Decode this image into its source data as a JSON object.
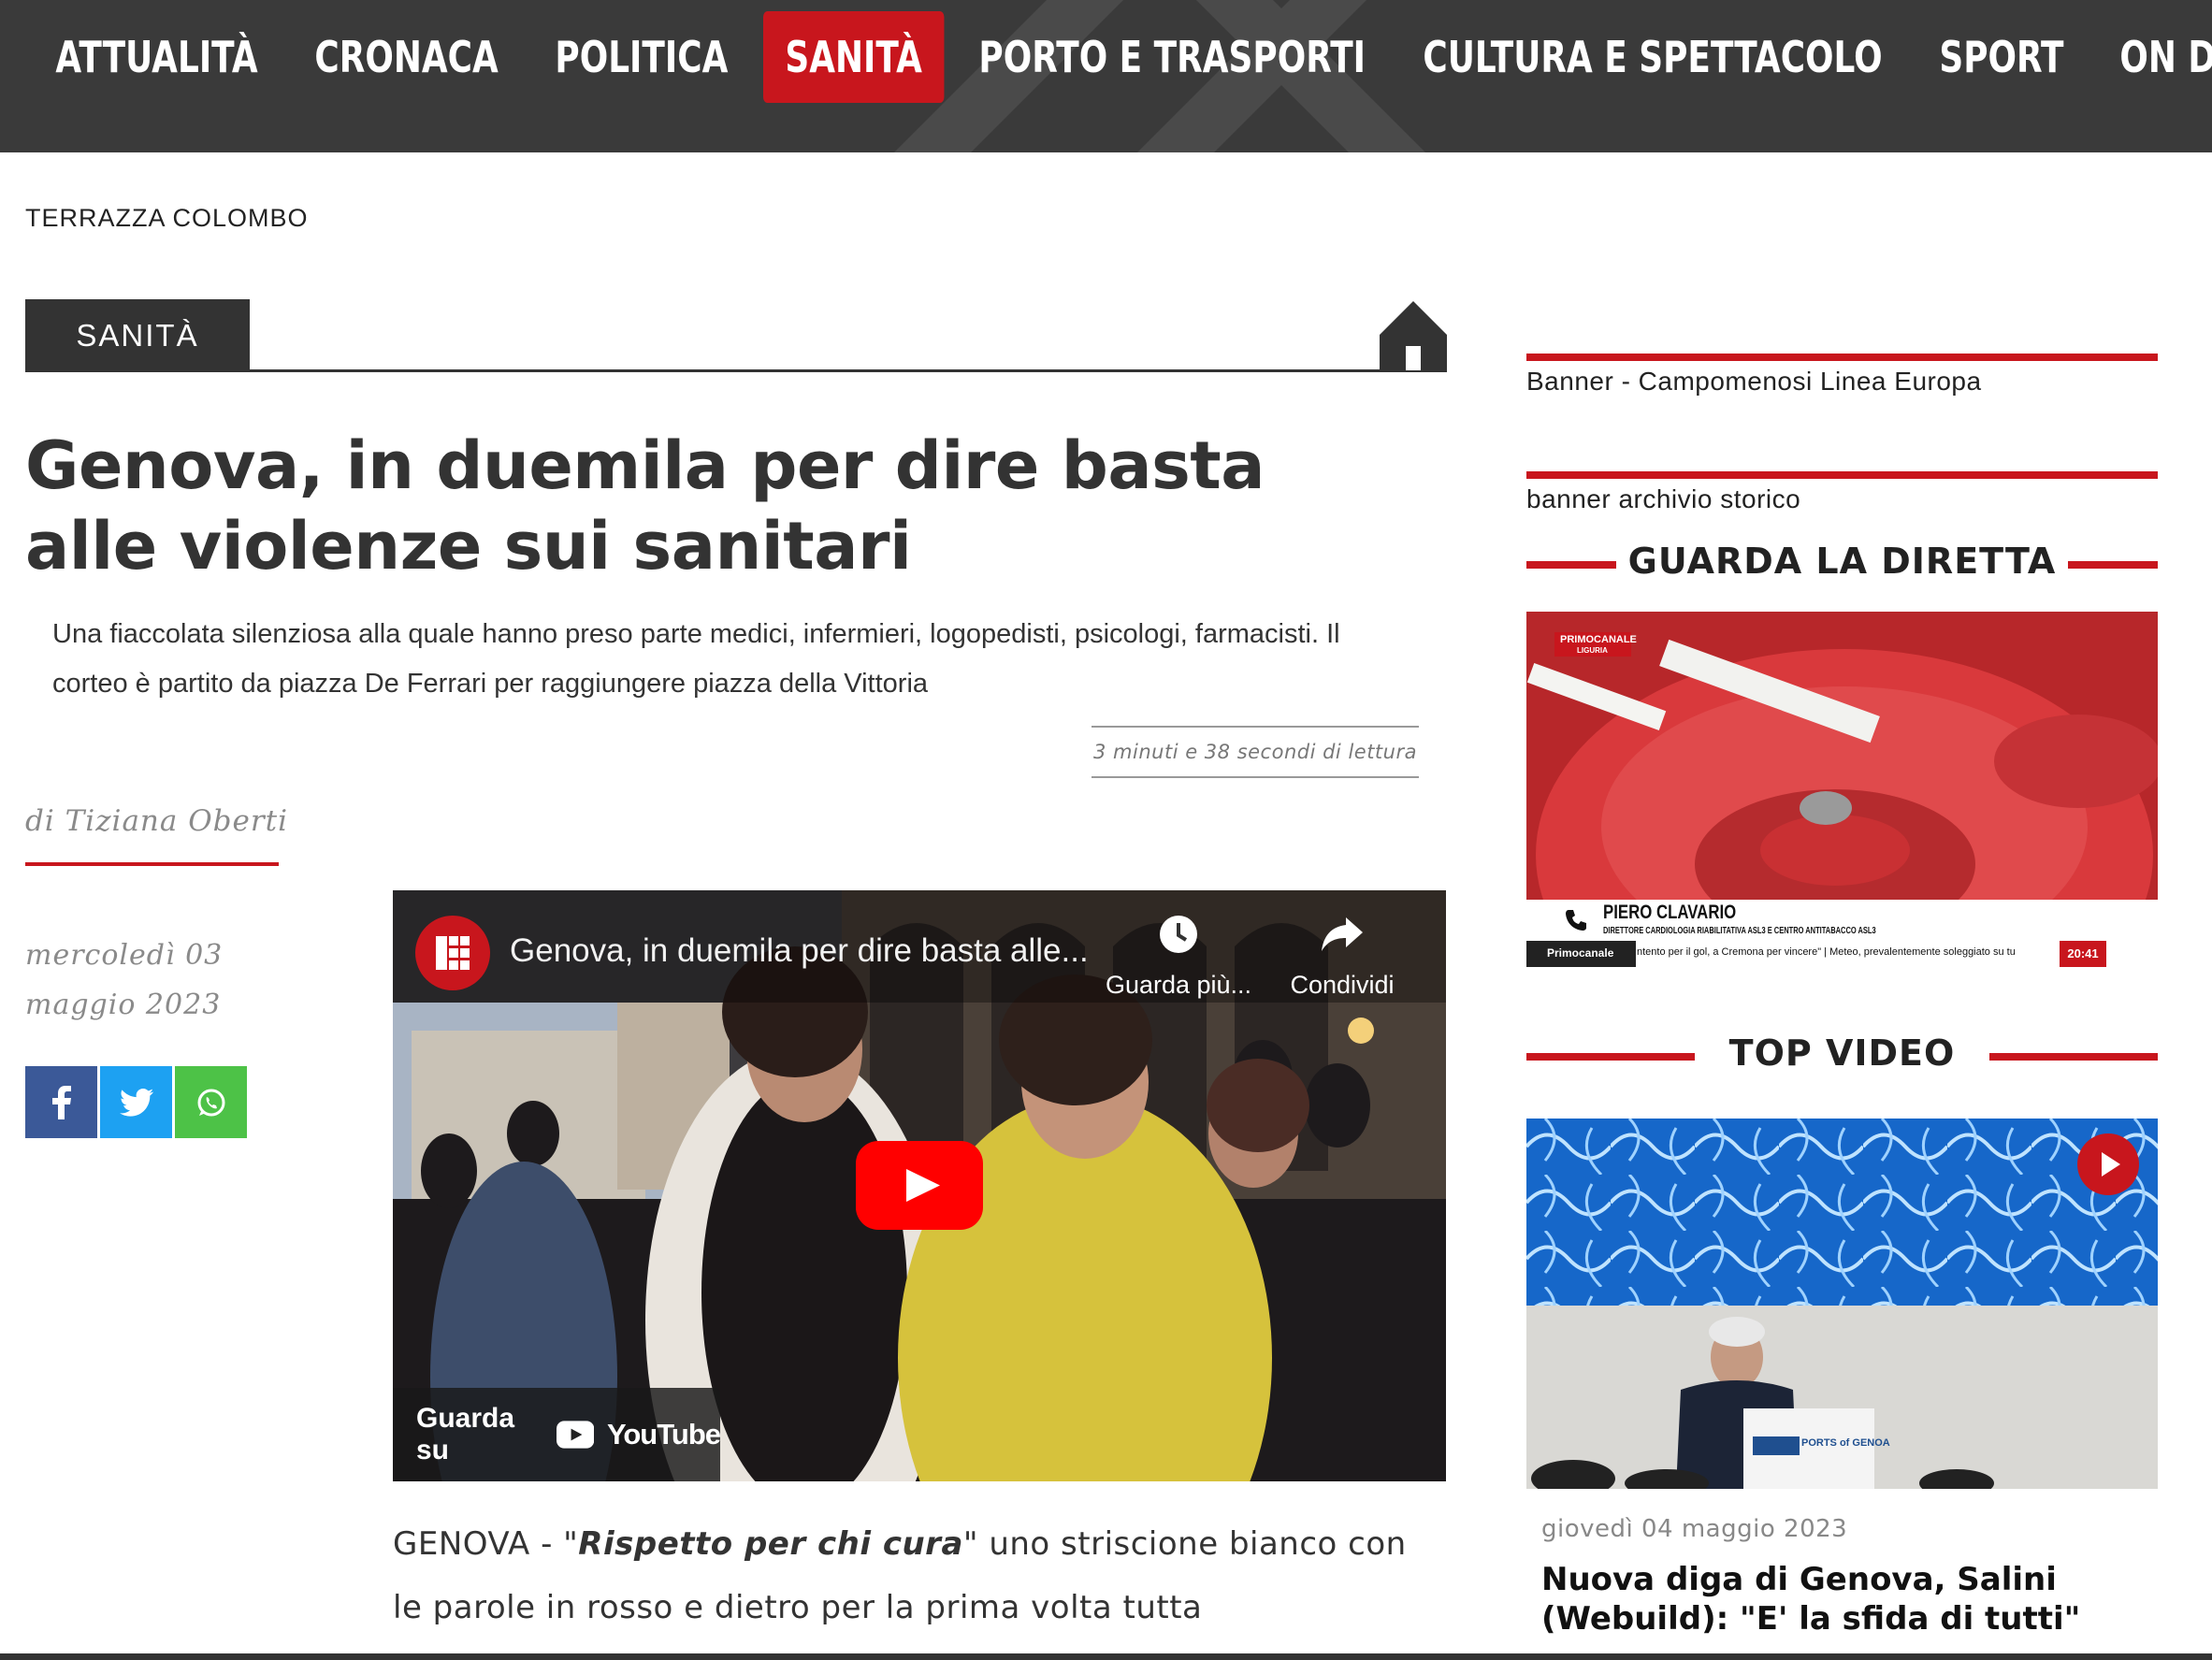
{
  "nav": {
    "items": [
      {
        "label": "ATTUALITÀ",
        "active": false
      },
      {
        "label": "CRONACA",
        "active": false
      },
      {
        "label": "POLITICA",
        "active": false
      },
      {
        "label": "SANITÀ",
        "active": true
      },
      {
        "label": "PORTO E TRASPORTI",
        "active": false
      },
      {
        "label": "CULTURA E SPETTACOLO",
        "active": false
      },
      {
        "label": "SPORT",
        "active": false
      },
      {
        "label": "ON DEMAND",
        "active": false
      }
    ],
    "active_color": "#c8161d"
  },
  "breadcrumb": "TERRAZZA COLOMBO",
  "section": {
    "label": "SANITÀ",
    "home_icon": "home-icon"
  },
  "article": {
    "title": "Genova, in duemila per dire basta alle violenze sui sanitari",
    "summary": "Una fiaccolata silenziosa alla quale hanno preso parte medici, infermieri, logopedisti, psicologi, farmacisti. Il corteo è partito da piazza De Ferrari per raggiungere piazza della Vittoria",
    "read_time": "3 minuti e 38 secondi di lettura",
    "author": "di Tiziana Oberti",
    "date": "mercoledì 03 maggio 2023",
    "body_prefix": "GENOVA - \"",
    "body_quote": "Rispetto per chi cura",
    "body_rest": "\" uno striscione bianco con le parole in rosso e dietro per la prima volta tutta"
  },
  "share": {
    "facebook": "facebook-icon",
    "twitter": "twitter-icon",
    "whatsapp": "whatsapp-icon"
  },
  "video": {
    "title": "Genova, in duemila per dire basta alle...",
    "watch_later": "Guarda più...",
    "share": "Condividi",
    "watch_on": "Guarda su",
    "youtube": "YouTube"
  },
  "sidebar": {
    "banner1": "Banner - Campomenosi Linea Europa",
    "banner2": "banner archivio storico",
    "live_heading": "GUARDA LA DIRETTA",
    "live_overlay": {
      "channel": "PRIMOCANALE",
      "region": "LIGURIA",
      "name": "PIERO CLAVARIO",
      "role": "DIRETTORE CARDIOLOGIA RIABILITATIVA ASL3 E CENTRO ANTITABACCO ASL3",
      "brand": "Primocanale",
      "ticker": "ntento per il gol, a Cremona per vincere\" | Meteo, prevalentemente soleggiato su tu",
      "time": "20:41"
    },
    "top_video_heading": "TOP VIDEO",
    "top_video": {
      "date": "giovedì 04 maggio 2023",
      "title": "Nuova diga di Genova, Salini (Webuild): \"E' la sfida di tutti\"",
      "podium_text": "PORTS of GENOA"
    }
  }
}
